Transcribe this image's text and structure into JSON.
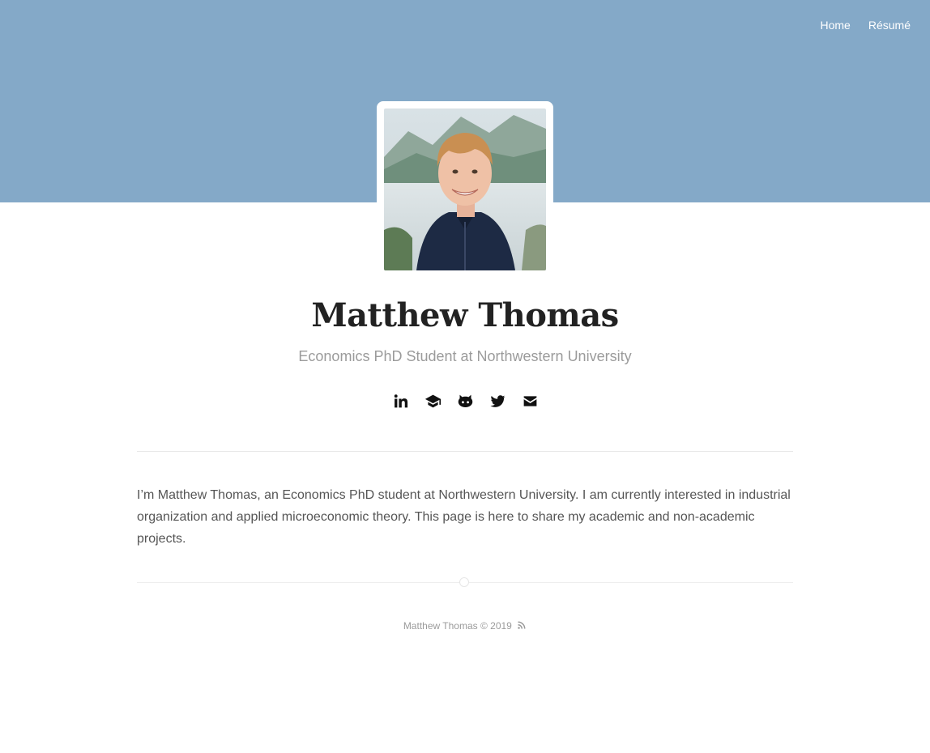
{
  "nav": {
    "items": [
      {
        "label": "Home"
      },
      {
        "label": "Résumé"
      }
    ]
  },
  "profile": {
    "name": "Matthew Thomas",
    "tagline": "Economics PhD Student at Northwestern University"
  },
  "social": {
    "icons": [
      "linkedin-icon",
      "graduation-cap-icon",
      "github-icon",
      "twitter-icon",
      "email-icon"
    ]
  },
  "bio": {
    "text": "I’m Matthew Thomas, an Economics PhD student at Northwestern University. I am currently interested in industrial organization and applied microeconomic theory. This page is here to share my academic and non-academic projects."
  },
  "footer": {
    "text": "Matthew Thomas © 2019",
    "icon": "rss-icon"
  },
  "colors": {
    "hero": "#84a9c8",
    "text": "#555555",
    "heading": "#222222",
    "muted": "#9b9b9b"
  }
}
